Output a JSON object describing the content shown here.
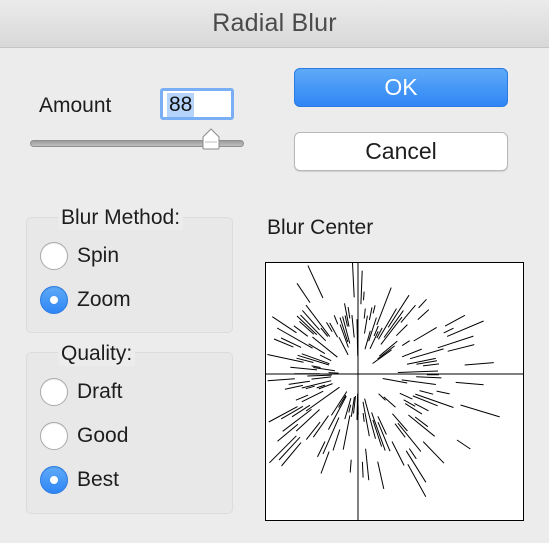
{
  "window": {
    "title": "Radial Blur"
  },
  "amount": {
    "label": "Amount",
    "value": "88",
    "slider_fraction": 0.88
  },
  "buttons": {
    "ok_label": "OK",
    "cancel_label": "Cancel"
  },
  "blur_method": {
    "title": "Blur Method:",
    "options": [
      {
        "label": "Spin",
        "selected": false
      },
      {
        "label": "Zoom",
        "selected": true
      }
    ]
  },
  "quality": {
    "title": "Quality:",
    "options": [
      {
        "label": "Draft",
        "selected": false
      },
      {
        "label": "Good",
        "selected": false
      },
      {
        "label": "Best",
        "selected": true
      }
    ]
  },
  "blur_center": {
    "label": "Blur Center"
  },
  "colors": {
    "accent": "#2f86f5",
    "window_background": "#ececec",
    "text_field_selection": "#b6d4fb"
  }
}
